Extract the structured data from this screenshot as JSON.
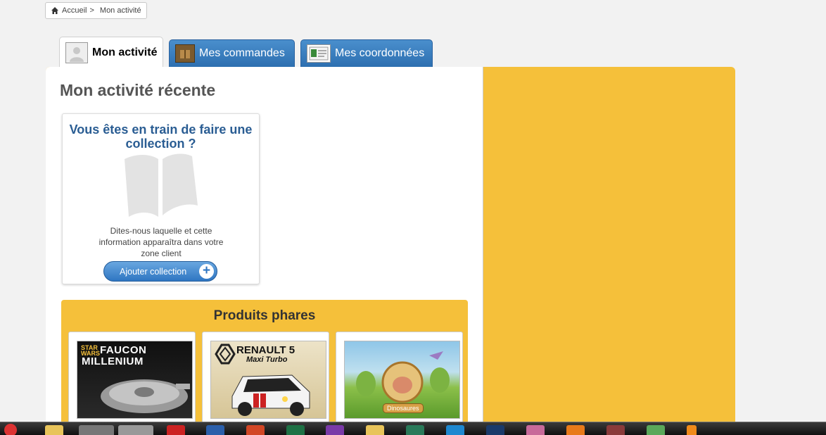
{
  "breadcrumb": {
    "home": "Accueil",
    "separator": ">",
    "current": "Mon activité"
  },
  "tabs": [
    {
      "label": "Mon activité",
      "active": true
    },
    {
      "label": "Mes commandes",
      "active": false
    },
    {
      "label": "Mes coordonnées",
      "active": false
    }
  ],
  "main": {
    "title": "Mon activité récente"
  },
  "collection_card": {
    "title": "Vous êtes en train de faire une collection ?",
    "text": "Dites-nous laquelle et cette information apparaîtra dans votre zone client",
    "button_label": "Ajouter collection"
  },
  "featured": {
    "title": "Produits phares",
    "products": [
      {
        "line1": "FAUCON",
        "line2": "MILLENIUM",
        "brand": "STAR WARS"
      },
      {
        "line1": "RENAULT 5",
        "line2": "Maxi Turbo"
      },
      {
        "line1": "Dinosaures"
      }
    ]
  },
  "colors": {
    "accent_yellow": "#f5c03a",
    "tab_blue": "#3a7fc0",
    "title_blue": "#2a5d93"
  }
}
